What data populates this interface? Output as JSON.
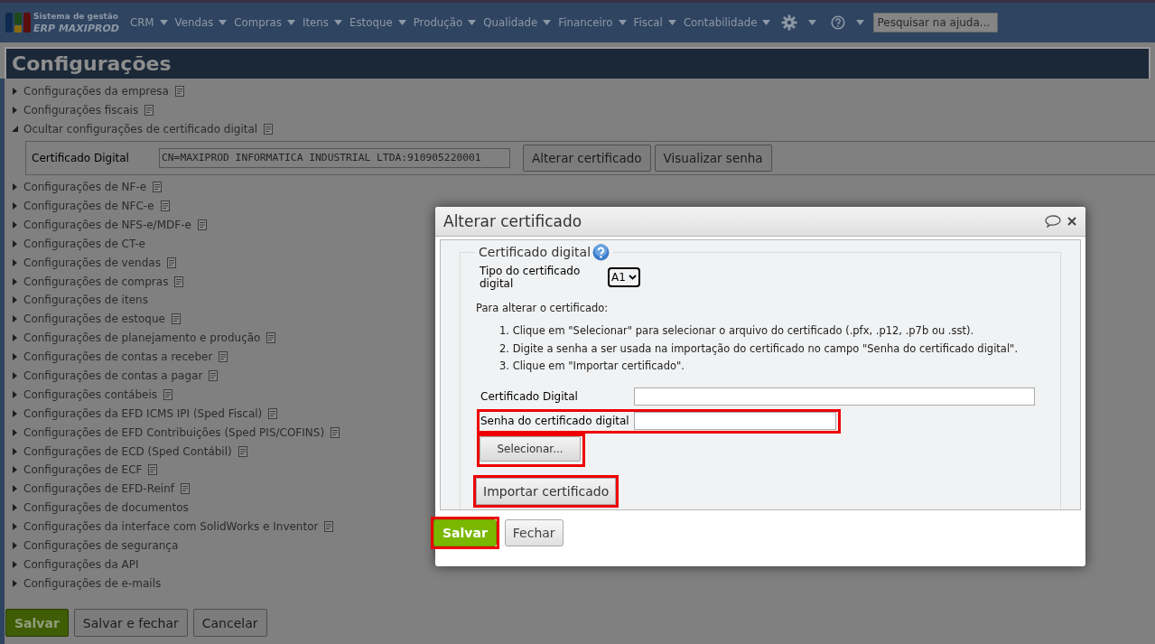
{
  "nav": {
    "logo_line1": "Sistema de gestão",
    "logo_line2": "ERP MAXIPROD",
    "menus": [
      {
        "kind": "text",
        "label": "CRM"
      },
      {
        "kind": "text",
        "label": "Vendas"
      },
      {
        "kind": "text",
        "label": "Compras"
      },
      {
        "kind": "text",
        "label": "Itens"
      },
      {
        "kind": "text",
        "label": "Estoque"
      },
      {
        "kind": "text",
        "label": "Produção"
      },
      {
        "kind": "text",
        "label": "Qualidade"
      },
      {
        "kind": "text",
        "label": "Financeiro"
      },
      {
        "kind": "text",
        "label": "Fiscal"
      },
      {
        "kind": "text",
        "label": "Contabilidade"
      },
      {
        "kind": "gear"
      },
      {
        "kind": "help"
      }
    ],
    "search": {
      "placeholder": "Pesquisar na ajuda..."
    }
  },
  "page": {
    "title": "Configurações"
  },
  "sections": [
    {
      "label": "Configurações da empresa",
      "expanded": false,
      "doc_icon": true
    },
    {
      "label": "Configurações fiscais",
      "expanded": false,
      "doc_icon": true
    },
    {
      "label": "Ocultar configurações de certificado digital",
      "expanded": true,
      "doc_icon": true,
      "fields": [
        {
          "label": "Certificado Digital",
          "value": "CN=MAXIPROD INFORMATICA INDUSTRIAL LTDA:910905220001"
        }
      ],
      "buttons": [
        "Alterar certificado",
        "Visualizar senha"
      ]
    },
    {
      "label": "Configurações de NF-e",
      "expanded": false,
      "doc_icon": true
    },
    {
      "label": "Configurações de NFC-e",
      "expanded": false,
      "doc_icon": true
    },
    {
      "label": "Configurações de NFS-e/MDF-e",
      "expanded": false,
      "doc_icon": true
    },
    {
      "label": "Configurações de CT-e",
      "expanded": false,
      "doc_icon": false
    },
    {
      "label": "Configurações de vendas",
      "expanded": false,
      "doc_icon": true
    },
    {
      "label": "Configurações de compras",
      "expanded": false,
      "doc_icon": true
    },
    {
      "label": "Configurações de itens",
      "expanded": false,
      "doc_icon": false
    },
    {
      "label": "Configurações de estoque",
      "expanded": false,
      "doc_icon": true
    },
    {
      "label": "Configurações de planejamento e produção",
      "expanded": false,
      "doc_icon": true
    },
    {
      "label": "Configurações de contas a receber",
      "expanded": false,
      "doc_icon": true
    },
    {
      "label": "Configurações de contas a pagar",
      "expanded": false,
      "doc_icon": true
    },
    {
      "label": "Configurações contábeis",
      "expanded": false,
      "doc_icon": true
    },
    {
      "label": "Configurações da EFD ICMS IPI (Sped Fiscal)",
      "expanded": false,
      "doc_icon": true
    },
    {
      "label": "Configurações de EFD Contribuições (Sped PIS/COFINS)",
      "expanded": false,
      "doc_icon": true
    },
    {
      "label": "Configurações de ECD (Sped Contábil)",
      "expanded": false,
      "doc_icon": true
    },
    {
      "label": "Configurações de ECF",
      "expanded": false,
      "doc_icon": true
    },
    {
      "label": "Configurações de EFD-Reinf",
      "expanded": false,
      "doc_icon": true
    },
    {
      "label": "Configurações de documentos",
      "expanded": false,
      "doc_icon": false
    },
    {
      "label": "Configurações da interface com SolidWorks e Inventor",
      "expanded": false,
      "doc_icon": true
    },
    {
      "label": "Configurações de segurança",
      "expanded": false,
      "doc_icon": false
    },
    {
      "label": "Configurações da API",
      "expanded": false,
      "doc_icon": false
    },
    {
      "label": "Configurações de e-mails",
      "expanded": false,
      "doc_icon": false
    }
  ],
  "footer_buttons": [
    {
      "label": "Salvar",
      "kind": "primary"
    },
    {
      "label": "Salvar e fechar",
      "kind": "secondary"
    },
    {
      "label": "Cancelar",
      "kind": "secondary"
    }
  ],
  "dialog": {
    "title": "Alterar certificado",
    "legend": "Certificado digital",
    "type_label": "Tipo do certificado digital",
    "type_value": "A1",
    "intro": "Para alterar o certificado:",
    "steps": [
      "1. Clique em \"Selecionar\" para selecionar o arquivo do certificado (.pfx, .p12, .p7b ou .sst).",
      "2. Digite a senha a ser usada na importação do certificado no campo \"Senha do certificado digital\".",
      "3. Clique em \"Importar certificado\"."
    ],
    "fields": [
      {
        "label": "Certificado Digital",
        "kind": "wide",
        "highlighted": false
      },
      {
        "label": "Senha do certificado digital",
        "kind": "short",
        "highlighted": true
      }
    ],
    "select_button": {
      "label": "Selecionar...",
      "highlighted": true
    },
    "import_button": {
      "label": "Importar certificado",
      "highlighted": true
    },
    "buttons": [
      {
        "label": "Salvar",
        "kind": "primary",
        "highlighted": true
      },
      {
        "label": "Fechar",
        "kind": "secondary",
        "highlighted": false
      }
    ]
  }
}
